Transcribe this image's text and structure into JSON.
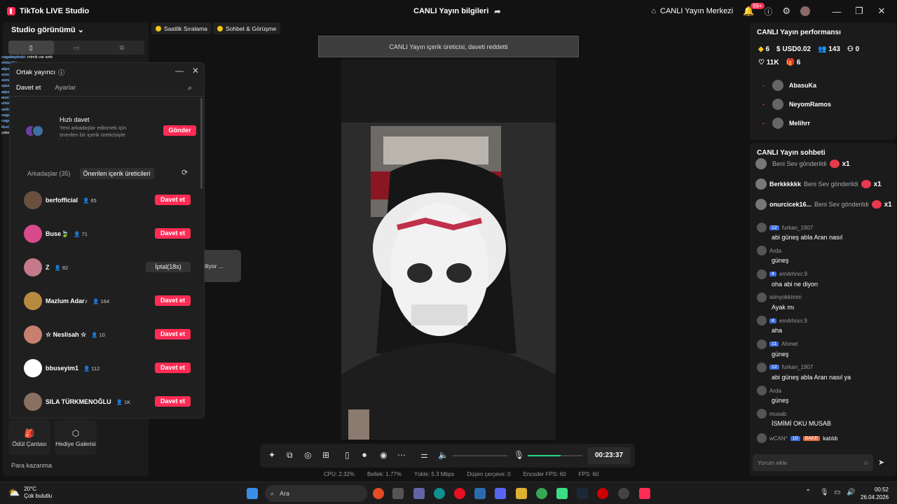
{
  "app": {
    "title": "TikTok LIVE Studio",
    "center_title": "CANLI Yayın bilgileri",
    "live_center": "CANLI Yayın Merkezi",
    "notif_badge": "99+"
  },
  "left": {
    "studio_view": "Studio görünümü",
    "mini_chat": [
      {
        "user": "cagabaykoki:",
        "text": "mimik var amk"
      },
      {
        "user": "vinicule:",
        "text": ""
      },
      {
        "user": "alpol-ofte:",
        "text": ""
      },
      {
        "user": "yusoffoo:",
        "text": ""
      },
      {
        "user": "eenoleter:",
        "text": ""
      },
      {
        "user": "spurakhe:",
        "text": ""
      },
      {
        "user": "alpol-ofte:",
        "text": ""
      },
      {
        "user": "wordex57:",
        "text": ""
      },
      {
        "user": "vinicule:",
        "text": ""
      },
      {
        "user": "selimyaabi:",
        "text": "amcaya bak twit"
      },
      {
        "user": "cagabaykoki:",
        "text": ""
      },
      {
        "user": "cagabaykoki:",
        "text": ""
      },
      {
        "user": "lice1834:",
        "text": "ekrem bu kelimeyi benden çaldın yalan atma"
      }
    ],
    "odul": "Ödül Çantası",
    "hediye": "Hediye Galerisi",
    "para": "Para kazanma"
  },
  "popup": {
    "title": "Ortak yayıncı",
    "tab_invite": "Davet et",
    "tab_settings": "Ayarlar",
    "quick_title": "Hızlı davet",
    "quick_desc": "Yeni arkadaşlar edinmek için önerilen bir içerik üreticisiyle birlikte ortak yayın yapın",
    "send": "Gönder",
    "friends_tab": "Arkadaşlar (35)",
    "suggested_tab": "Önerilen içerik üreticileri",
    "invite_label": "Davet et",
    "cancel_label": "İptal(18s)",
    "creators": [
      {
        "name": "berfofficial",
        "count": "65",
        "state": "invite",
        "color": "#6b5040"
      },
      {
        "name": "Buse🍃",
        "count": "71",
        "state": "invite",
        "color": "#d94a8c"
      },
      {
        "name": "Z",
        "count": "82",
        "state": "cancel",
        "color": "#c47a8a"
      },
      {
        "name": "Mazlum Adar♪",
        "count": "164",
        "state": "invite",
        "color": "#b88a40"
      },
      {
        "name": "☆ Neslisah ☆",
        "count": "10",
        "state": "invite",
        "color": "#c78070"
      },
      {
        "name": "bbuseyim1",
        "count": "112",
        "state": "invite",
        "color": "#ffffff"
      },
      {
        "name": "SILA TÜRKMENOĞLU",
        "count": "1K",
        "state": "invite",
        "color": "#8a7060"
      }
    ]
  },
  "center": {
    "pill1": "Saatlik Sıralama",
    "pill2": "Sohbet & Görüşme",
    "toast": "CANLI Yayın içerik üreticisi, daveti reddetti",
    "ghost": "iliyor ...",
    "timer": "00:23:37",
    "volume_level": 0.6,
    "stats": {
      "cpu": "CPU:  2.32%",
      "mem": "Bellek:  1.77%",
      "upload": "Yükle:  5.3 Mbps",
      "dropped": "Düşen çerçeve:  0",
      "enc_fps": "Encoder FPS:  60",
      "fps": "FPS:  60"
    }
  },
  "perf": {
    "title": "CANLI Yayın performansı",
    "coins": "6",
    "usd": "USD0.02",
    "viewers": "143",
    "new_followers": "0",
    "likes": "11K",
    "gifters": "6",
    "ranking": [
      "AbasuKa",
      "NeyomRamos",
      "Melihrr"
    ]
  },
  "chat": {
    "title": "CANLI Yayın sohbeti",
    "gifts": [
      {
        "name": "",
        "msg": "Beni Sev gönderildi",
        "count": "x1"
      },
      {
        "name": "Berkkkkkk",
        "msg": "Beni Sev gönderildi",
        "count": "x1"
      },
      {
        "name": "onurcicek16...",
        "msg": "Beni Sev gönderildi",
        "count": "x1"
      }
    ],
    "messages": [
      {
        "user": "furkan_1907",
        "level": "12",
        "text": "abi güneş abla Aran nasıl"
      },
      {
        "user": "Arda",
        "level": "",
        "text": "güneş"
      },
      {
        "user": "em4rhncr.9",
        "level": "4",
        "text": "oha abi ne diyon"
      },
      {
        "user": "isimyokkimm",
        "level": "",
        "text": "Ayak mı"
      },
      {
        "user": "em4rhncr.9",
        "level": "4",
        "text": "aha"
      },
      {
        "user": "Ahmet",
        "level": "11",
        "text": "güneş"
      },
      {
        "user": "furkan_1907",
        "level": "12",
        "text": "abi güneş abla Aran nasıl ya"
      },
      {
        "user": "Arda",
        "level": "",
        "text": "güneş"
      },
      {
        "user": "musab",
        "level": "",
        "text": "İSMİMİ OKU MUSAB"
      }
    ],
    "join": {
      "user": "wCAN*",
      "level": "10",
      "tag": "BAKE",
      "text": "katıldı"
    },
    "placeholder": "Yorum ekle"
  },
  "taskbar": {
    "temp": "20°C",
    "weather": "Çok bulutlu",
    "search": "Ara",
    "time": "00:52",
    "date": "26.04.2026"
  }
}
